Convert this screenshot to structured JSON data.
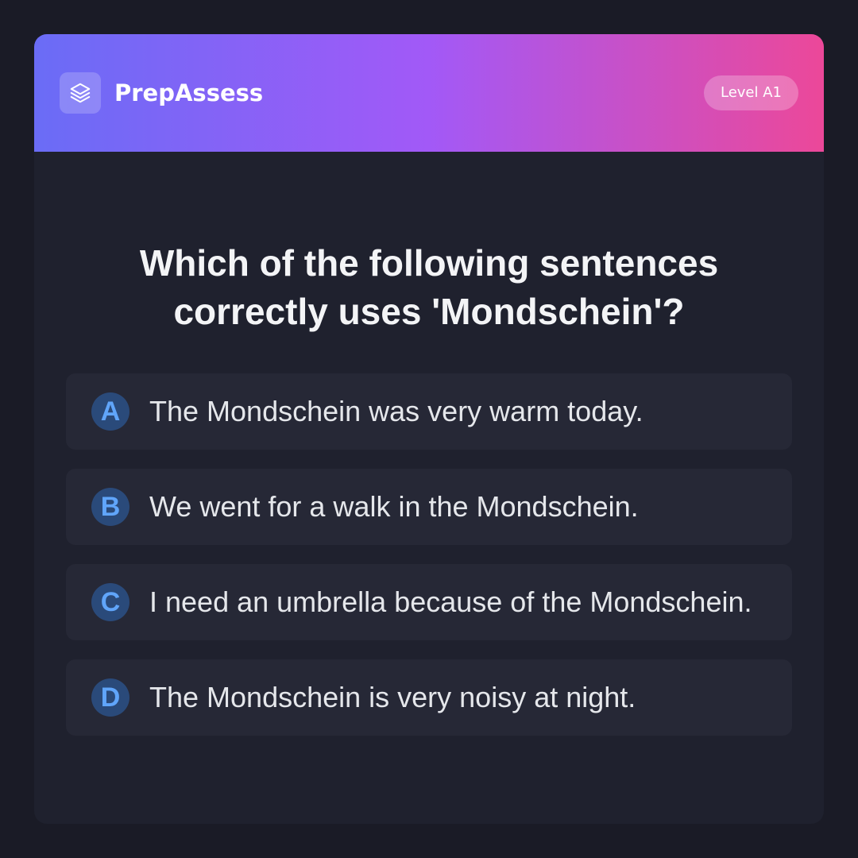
{
  "header": {
    "brand": "PrepAssess",
    "logo_icon": "layers-icon",
    "level": "Level A1",
    "gradient": [
      "#6a6cf6",
      "#a259f7",
      "#ec4899"
    ]
  },
  "question": {
    "text": "Which of the following sentences correctly uses 'Mondschein'?"
  },
  "options": [
    {
      "letter": "A",
      "text": "The Mondschein was very warm today."
    },
    {
      "letter": "B",
      "text": "We went for a walk in the Mondschein."
    },
    {
      "letter": "C",
      "text": "I need an umbrella because of the Mondschein."
    },
    {
      "letter": "D",
      "text": "The Mondschein is very noisy at night."
    }
  ],
  "colors": {
    "background": "#1a1b26",
    "card": "#1f212e",
    "option_bg": "#262836",
    "accent": "#60a5fa"
  }
}
